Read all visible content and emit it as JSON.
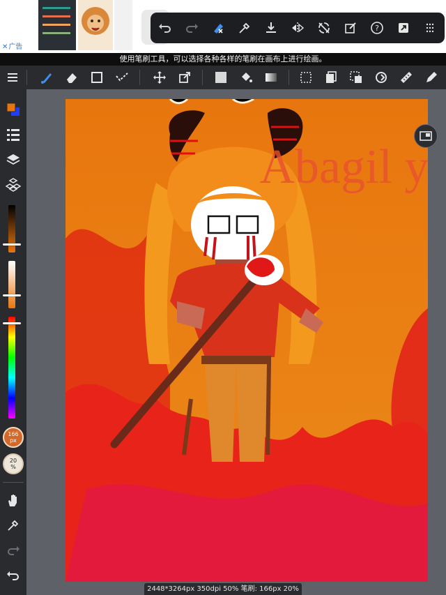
{
  "ad": {
    "close_label": "广告",
    "close_icon": "close-icon"
  },
  "quickbar": {
    "buttons": [
      "undo-icon",
      "redo-icon",
      "clear-layer-icon",
      "eyedropper-icon",
      "import-icon",
      "flip-horizontal-icon",
      "rotate-lock-icon",
      "transform-select-icon",
      "help-icon",
      "share-icon",
      "grid-menu-icon"
    ]
  },
  "hint": {
    "text": "使用笔刷工具，可以选择各种各样的笔刷在画布上进行绘画。"
  },
  "toolbar": {
    "tools": [
      "menu-icon",
      "brush-icon",
      "eraser-icon",
      "shape-icon",
      "select-brush-icon",
      "move-icon",
      "transform-icon",
      "fill-color-icon",
      "bucket-icon",
      "gradient-icon",
      "selection-icon",
      "copy-layer-icon",
      "select-area-icon",
      "lasso-rotate-icon",
      "ruler-icon",
      "pen-icon"
    ]
  },
  "leftpanel": {
    "primary_color": "#e8760e",
    "secondary_color": "#1f3cff",
    "brush_size": {
      "value": "166",
      "unit": "px"
    },
    "opacity": {
      "value": "20",
      "unit": "%"
    },
    "brightness_level": 0.82,
    "saturation_level": 0.72,
    "hue_level": 0.06
  },
  "status": {
    "text": "2448*3264px 350dpi 50% 笔刷: 166px 20%"
  },
  "canvas": {
    "signature_text": "Abagil y"
  },
  "colors": {
    "accent": "#3f8ff0",
    "toolbar_bg": "#2a2b2f",
    "canvas_bg": "#e8760e"
  }
}
